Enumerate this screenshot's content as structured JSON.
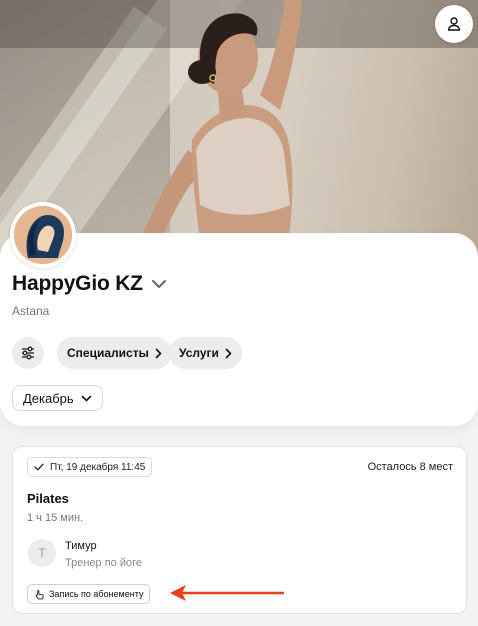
{
  "hero": {
    "alt": "woman in yoga stretch"
  },
  "header": {
    "profile_icon": "user-icon"
  },
  "studio": {
    "name": "HappyGio KZ",
    "city": "Astana",
    "name_chevron_icon": "chevron-down-icon"
  },
  "filters": {
    "filter_icon": "sliders-icon",
    "chips": [
      {
        "label": "Специалисты",
        "icon": "chevron-right-icon"
      },
      {
        "label": "Услуги",
        "icon": "chevron-right-icon"
      }
    ],
    "month": {
      "label": "Декабрь",
      "icon": "chevron-down-icon"
    }
  },
  "session": {
    "date": "Пт, 19 декабря 11:45",
    "seats_left": "Осталось 8 мест",
    "title": "Pilates",
    "duration": "1 ч 15 мин.",
    "trainer": {
      "initial": "Т",
      "name": "Тимур",
      "role": "Тренер по йоге"
    },
    "subscription_button": "Запись по абонементу"
  },
  "annotation": {
    "arrow_color": "#e8401c"
  },
  "colors": {
    "chip_bg": "#ececec",
    "card_bg": "#ffffff",
    "page_bg": "#f2f2f2"
  }
}
